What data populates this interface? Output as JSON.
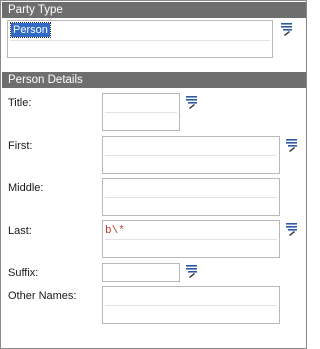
{
  "party_type": {
    "header": "Party Type",
    "selected_value": "Person"
  },
  "person_details": {
    "header": "Person Details",
    "fields": {
      "title": {
        "label": "Title:"
      },
      "first": {
        "label": "First:"
      },
      "middle": {
        "label": "Middle:"
      },
      "last": {
        "label": "Last:",
        "value": "b\\*"
      },
      "suffix": {
        "label": "Suffix:"
      },
      "other_names": {
        "label": "Other Names:"
      }
    }
  },
  "colors": {
    "header_bg": "#6e6e6e",
    "selection_bg": "#316ac5",
    "typed_text": "#c0392b",
    "icon_blue": "#2c5aa0"
  },
  "icons": {
    "picker": "list-picker-icon"
  }
}
